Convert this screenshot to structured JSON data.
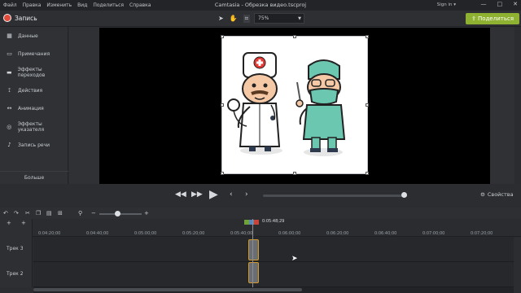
{
  "window": {
    "title": "Camtasia - Обрезка видео.tscproj",
    "menu": [
      "Файл",
      "Правка",
      "Изменить",
      "Вид",
      "Поделиться",
      "Справка"
    ],
    "sign_in": "Sign in ▾",
    "controls": [
      "—",
      "□",
      "✕"
    ]
  },
  "toolbar": {
    "record_label": "Запись",
    "zoom_value": "75%",
    "share_label": "Поделиться",
    "tools": [
      "select-icon",
      "hand-icon",
      "crop-icon"
    ]
  },
  "left_panel": {
    "items": [
      {
        "label": "Данные",
        "icon": "media-icon"
      },
      {
        "label": "Примечания",
        "icon": "annotation-icon"
      },
      {
        "label": "Эффекты переходов",
        "icon": "transition-icon"
      },
      {
        "label": "Действия",
        "icon": "behavior-icon"
      },
      {
        "label": "Анимация",
        "icon": "animation-icon"
      },
      {
        "label": "Эффекты указателя",
        "icon": "cursor-effects-icon"
      },
      {
        "label": "Запись речи",
        "icon": "microphone-icon"
      }
    ],
    "more_label": "Больше"
  },
  "player": {
    "properties_label": "Свойства",
    "progress": 0.98
  },
  "timeline": {
    "playhead_time": "0:05:48;29",
    "ticks": [
      "0:04:20;00",
      "0:04:40;00",
      "0:05:00;00",
      "0:05:20;00",
      "0:05:40;00",
      "0:06:00;00",
      "0:06:20;00",
      "0:06:40;00",
      "0:07:00;00",
      "0:07:20;00"
    ],
    "tracks": [
      {
        "name": "Трек 3"
      },
      {
        "name": "Трек 2"
      }
    ]
  },
  "colors": {
    "accent_green": "#8fb131",
    "record_red": "#e24a3b",
    "clip_border": "#d29a2a"
  }
}
